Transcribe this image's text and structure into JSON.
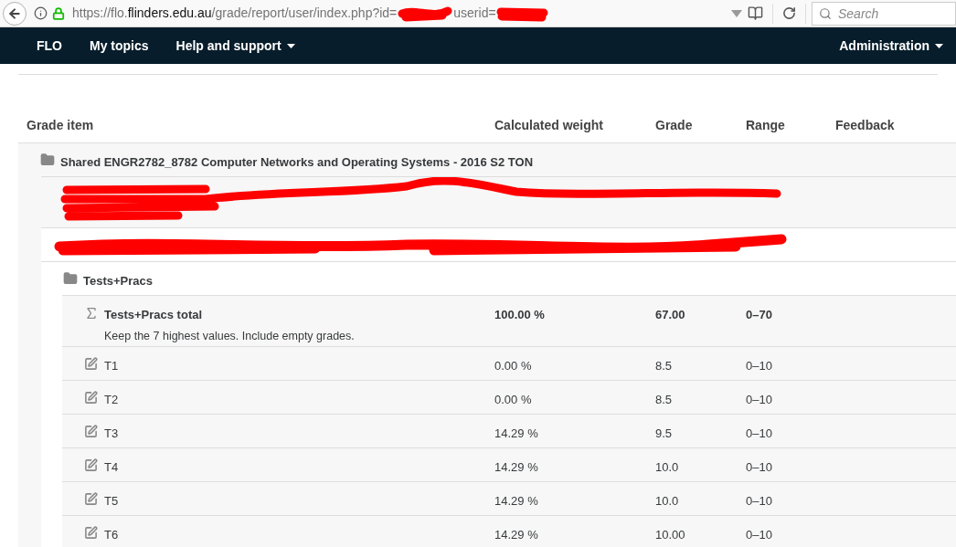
{
  "browser": {
    "url": {
      "prefix": "https://flo.",
      "domain": "flinders.edu.au",
      "path": "/grade/report/user/index.php?id="
    },
    "url_tail": "userid=",
    "search": {
      "placeholder": "Search"
    }
  },
  "navbar": {
    "items": [
      {
        "label": "FLO",
        "dropdown": false
      },
      {
        "label": "My topics",
        "dropdown": false
      },
      {
        "label": "Help and support",
        "dropdown": true
      }
    ],
    "right_item": {
      "label": "Administration",
      "dropdown": true
    }
  },
  "table": {
    "columns": [
      "Grade item",
      "Calculated weight",
      "Grade",
      "Range",
      "Feedback"
    ],
    "rows": [
      {
        "kind": "category",
        "redacted": false,
        "name": "Shared ENGR2782_8782 Computer Networks and Operating Systems - 2016 S2 TON",
        "children": [
          {
            "kind": "item",
            "redacted": true
          },
          {
            "kind": "category",
            "redacted": true
          },
          {
            "kind": "category",
            "redacted": false,
            "name": "Tests+Pracs",
            "children": [
              {
                "kind": "total",
                "redacted": false,
                "name": "Tests+Pracs total",
                "note": "Keep the 7 highest values. Include empty grades.",
                "weight": "100.00 %",
                "grade": "67.00",
                "range": "0–70"
              },
              {
                "kind": "item",
                "redacted": false,
                "name": "T1",
                "weight": "0.00 %",
                "grade": "8.5",
                "range": "0–10"
              },
              {
                "kind": "item",
                "redacted": false,
                "name": "T2",
                "weight": "0.00 %",
                "grade": "8.5",
                "range": "0–10"
              },
              {
                "kind": "item",
                "redacted": false,
                "name": "T3",
                "weight": "14.29 %",
                "grade": "9.5",
                "range": "0–10"
              },
              {
                "kind": "item",
                "redacted": false,
                "name": "T4",
                "weight": "14.29 %",
                "grade": "10.0",
                "range": "0–10"
              },
              {
                "kind": "item",
                "redacted": false,
                "name": "T5",
                "weight": "14.29 %",
                "grade": "10.0",
                "range": "0–10"
              },
              {
                "kind": "item",
                "redacted": false,
                "name": "T6",
                "weight": "14.29 %",
                "grade": "10.00",
                "range": "0–10"
              }
            ]
          }
        ]
      }
    ]
  }
}
